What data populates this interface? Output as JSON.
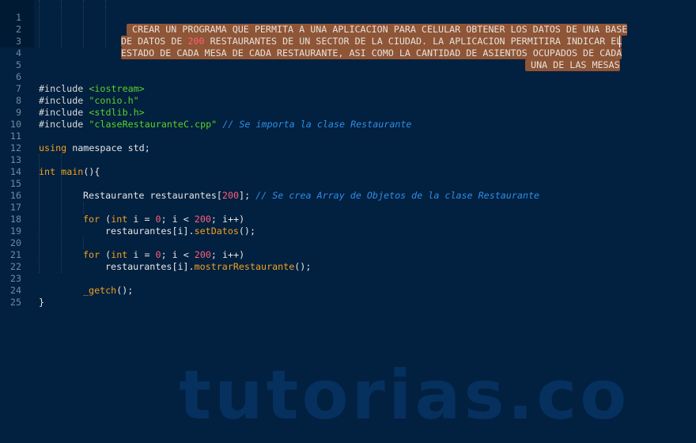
{
  "editor": {
    "theme_colors": {
      "background": "#02203f",
      "selection": "#8e5537",
      "keyword": "#f0a020",
      "string": "#5ad12b",
      "comment": "#2f8ee6",
      "number": "#ff5f7a"
    },
    "lines": [
      {
        "n": "1",
        "sel_text": " CREAR UN PROGRAMA QUE PERMITA A UNA APLICACION PARA CELULAR OBTENER LOS DATOS DE UNA BASE"
      },
      {
        "n": "2",
        "sel_pre": "DE DATOS DE ",
        "sel_num": "200",
        "sel_post": " RESTAURANTES DE UN SECTOR DE LA CIUDAD. LA APLICACION PERMITIRA INDICAR EL"
      },
      {
        "n": "3",
        "sel_text": "ESTADO DE CADA MESA DE CADA RESTAURANTE, ASI COMO LA CANTIDAD DE ASIENTOS OCUPADOS DE CADA"
      },
      {
        "n": "4",
        "sel_text": " UNA DE LAS MESAS"
      },
      {
        "n": "5"
      },
      {
        "n": "6",
        "directive": "#include ",
        "lib": "<iostream>"
      },
      {
        "n": "7",
        "directive": "#include ",
        "lib": "\"conio.h\""
      },
      {
        "n": "8",
        "directive": "#include ",
        "lib": "<stdlib.h>"
      },
      {
        "n": "9",
        "directive": "#include ",
        "lib": "\"claseRestauranteC.cpp\"",
        "comment": " // Se importa la clase Restaurante"
      },
      {
        "n": "10"
      },
      {
        "n": "11",
        "kw": "using",
        "rest": " namespace std;"
      },
      {
        "n": "12"
      },
      {
        "n": "13",
        "kw": "int",
        "sp": " ",
        "fn": "main",
        "rest": "(){"
      },
      {
        "n": "14"
      },
      {
        "n": "15",
        "pre": "Restaurante restaurantes[",
        "num": "200",
        "post": "];",
        "comment": " // Se crea Array de Objetos de la clase Restaurante"
      },
      {
        "n": "16"
      },
      {
        "n": "17",
        "kw1": "for",
        "t1": " (",
        "kw2": "int",
        "t2": " i = ",
        "num1": "0",
        "t3": "; i < ",
        "num2": "200",
        "t4": "; i++)"
      },
      {
        "n": "18",
        "pre": "restaurantes[i].",
        "fn": "setDatos",
        "post": "();"
      },
      {
        "n": "19"
      },
      {
        "n": "20",
        "kw1": "for",
        "t1": " (",
        "kw2": "int",
        "t2": " i = ",
        "num1": "0",
        "t3": "; i < ",
        "num2": "200",
        "t4": "; i++)"
      },
      {
        "n": "21",
        "pre": "restaurantes[i].",
        "fn": "mostrarRestaurante",
        "post": "();"
      },
      {
        "n": "22"
      },
      {
        "n": "23",
        "fn": "_getch",
        "post": "();"
      },
      {
        "n": "24",
        "rest": "}"
      },
      {
        "n": "25"
      }
    ]
  },
  "watermark": "tutorias.co"
}
